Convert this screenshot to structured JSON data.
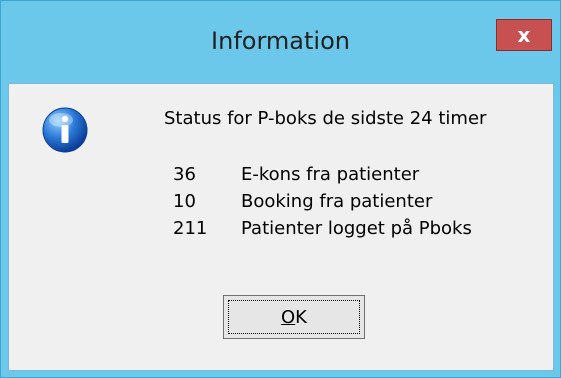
{
  "window": {
    "title": "Information",
    "close_label": "x"
  },
  "dialog": {
    "icon": "information-icon",
    "message": "Status for P-boks de sidste 24 timer",
    "rows": [
      {
        "count": "36",
        "label": "E-kons fra patienter"
      },
      {
        "count": "10",
        "label": "Booking fra patienter"
      },
      {
        "count": "211",
        "label": "Patienter logget på Pboks"
      }
    ],
    "ok_label_mnemonic": "O",
    "ok_label_rest": "K"
  },
  "colors": {
    "titlebar": "#6bc8ea",
    "close_button": "#c75050",
    "client_area": "#f0f0f0"
  }
}
